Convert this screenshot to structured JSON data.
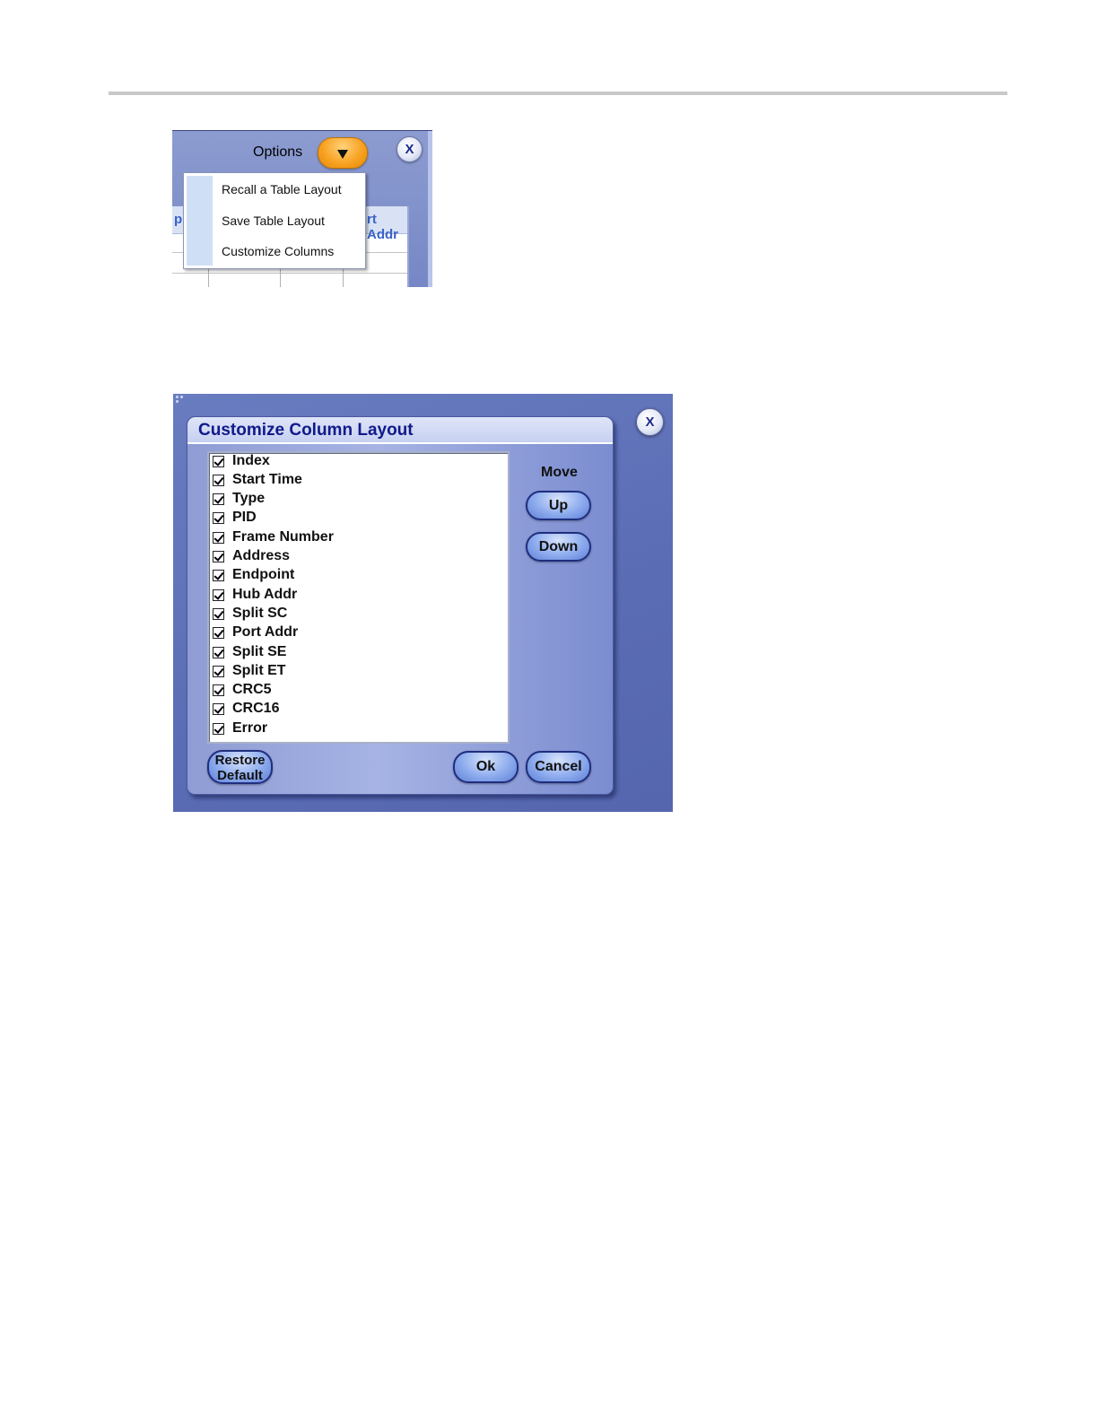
{
  "options_menu": {
    "label": "Options",
    "close_label": "X",
    "table_header_left": "p",
    "table_header_right": "rt Addr",
    "items": [
      "Recall a Table Layout",
      "Save Table Layout",
      "Customize Columns"
    ]
  },
  "dialog": {
    "title": "Customize Column Layout",
    "close_label": "X",
    "columns": [
      {
        "label": "Index",
        "checked": true
      },
      {
        "label": "Start Time",
        "checked": true
      },
      {
        "label": "Type",
        "checked": true
      },
      {
        "label": "PID",
        "checked": true
      },
      {
        "label": "Frame Number",
        "checked": true
      },
      {
        "label": "Address",
        "checked": true
      },
      {
        "label": "Endpoint",
        "checked": true
      },
      {
        "label": "Hub Addr",
        "checked": true
      },
      {
        "label": "Split SC",
        "checked": true
      },
      {
        "label": "Port Addr",
        "checked": true
      },
      {
        "label": "Split SE",
        "checked": true
      },
      {
        "label": "Split ET",
        "checked": true
      },
      {
        "label": "CRC5",
        "checked": true
      },
      {
        "label": "CRC16",
        "checked": true
      },
      {
        "label": "Error",
        "checked": true
      }
    ],
    "move_label": "Move",
    "up_label": "Up",
    "down_label": "Down",
    "restore_default_label": "Restore Default",
    "ok_label": "Ok",
    "cancel_label": "Cancel"
  },
  "colors": {
    "options_button": "#f7a01e",
    "dialog_background": "#5a6cb4",
    "title_text": "#101a8a",
    "pill_button": "#8eacee"
  }
}
